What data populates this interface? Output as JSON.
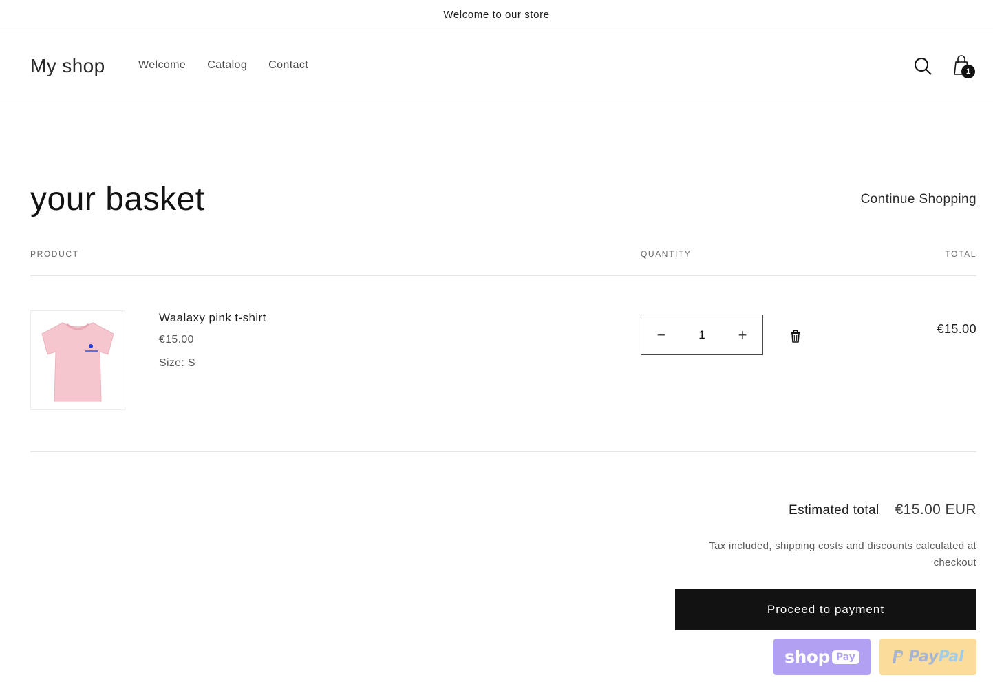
{
  "announcement": {
    "text": "Welcome to our store"
  },
  "header": {
    "logo": "My shop",
    "nav": [
      "Welcome",
      "Catalog",
      "Contact"
    ],
    "cart_count": "1",
    "icons": {
      "search": "search-icon",
      "cart": "shopping-bag-icon"
    }
  },
  "cart": {
    "title": "your basket",
    "continue_link": "Continue Shopping",
    "columns": {
      "product": "PRODUCT",
      "quantity": "QUANTITY",
      "total": "TOTAL"
    },
    "items": [
      {
        "name": "Waalaxy pink t-shirt",
        "price": "€15.00",
        "size": "Size: S",
        "quantity": "1",
        "line_total": "€15.00",
        "image_color": "#f5c6cd"
      }
    ],
    "qty_minus": "−",
    "qty_plus": "+"
  },
  "summary": {
    "estimated_label": "Estimated total",
    "estimated_value": "€15.00 EUR",
    "tax_note": "Tax included, shipping costs and discounts calculated at checkout",
    "checkout_button": "Proceed to payment"
  },
  "payments": {
    "shoppay_word": "shop",
    "shoppay_badge": "Pay",
    "paypal_pay": "Pay",
    "paypal_pal": "Pal",
    "shoppay_color": "#b2a1f2",
    "paypal_color": "#fbdc9b"
  }
}
